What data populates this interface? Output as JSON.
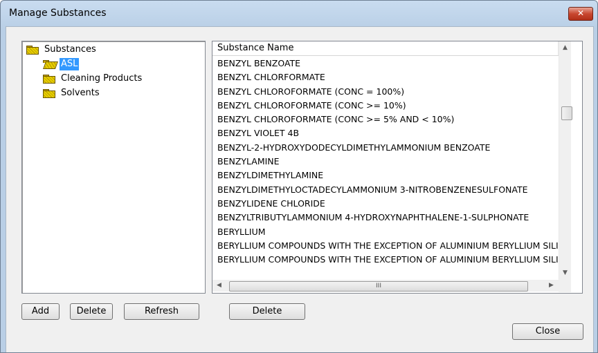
{
  "window": {
    "title": "Manage Substances",
    "close_glyph": "✕"
  },
  "tree": {
    "root": "Substances",
    "children": [
      "ASL",
      "Cleaning Products",
      "Solvents"
    ],
    "selected": "ASL"
  },
  "list": {
    "column_header": "Substance Name",
    "rows": [
      "BENZYL BENZOATE",
      "BENZYL CHLORFORMATE",
      "BENZYL CHLOROFORMATE (CONC = 100%)",
      "BENZYL CHLOROFORMATE (CONC >= 10%)",
      "BENZYL CHLOROFORMATE (CONC >= 5% AND < 10%)",
      "BENZYL VIOLET 4B",
      "BENZYL-2-HYDROXYDODECYLDIMETHYLAMMONIUM BENZOATE",
      "BENZYLAMINE",
      "BENZYLDIMETHYLAMINE",
      "BENZYLDIMETHYLOCTADECYLAMMONIUM 3-NITROBENZENESULFONATE",
      "BENZYLIDENE CHLORIDE",
      "BENZYLTRIBUTYLAMMONIUM 4-HYDROXYNAPHTHALENE-1-SULPHONATE",
      "BERYLLIUM",
      "BERYLLIUM COMPOUNDS WITH THE EXCEPTION OF ALUMINIUM BERYLLIUM SILICATES",
      "BERYLLIUM COMPOUNDS WITH THE EXCEPTION OF ALUMINIUM BERYLLIUM SILICATES"
    ],
    "hscroll_thumb_glyph": "III"
  },
  "buttons": {
    "add": "Add",
    "delete_left": "Delete",
    "refresh": "Refresh",
    "delete_right": "Delete",
    "close": "Close"
  },
  "colors": {
    "selection": "#3399ff",
    "title_gradient_top": "#c9dcf0"
  }
}
